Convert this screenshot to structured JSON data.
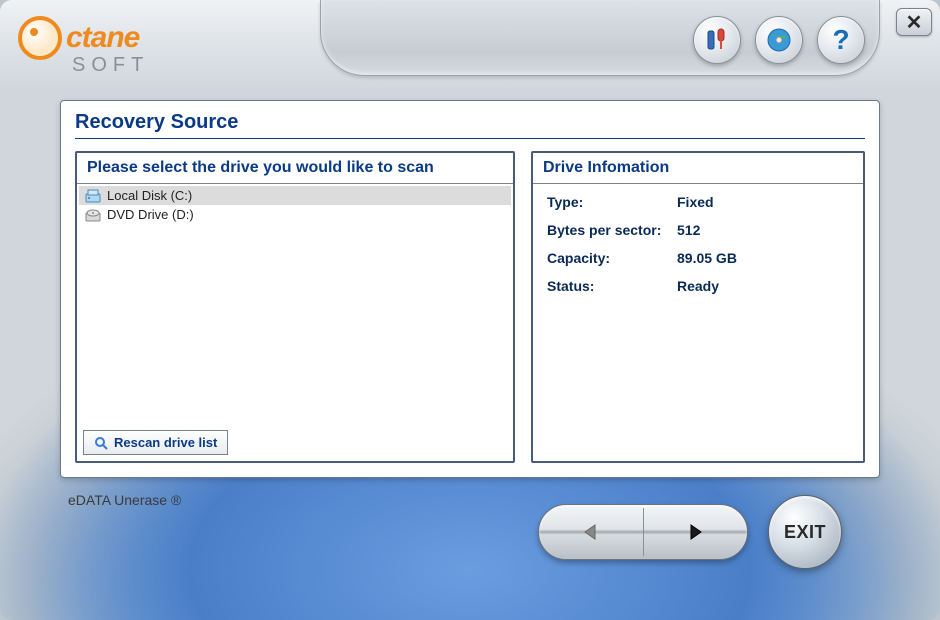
{
  "logo": {
    "word": "ctane",
    "sub": "SOFT"
  },
  "header": {
    "icons": [
      "tools-icon",
      "world-disc-icon",
      "help-icon"
    ]
  },
  "main": {
    "title": "Recovery Source",
    "drive_header": "Please select the drive you would like to scan",
    "drives": [
      {
        "label": "Local Disk (C:)",
        "icon": "hdd-icon",
        "selected": true
      },
      {
        "label": "DVD Drive (D:)",
        "icon": "dvd-icon",
        "selected": false
      }
    ],
    "rescan_label": "Rescan drive list",
    "info_header": "Drive Infomation",
    "info": [
      {
        "label": "Type:",
        "value": "Fixed"
      },
      {
        "label": "Bytes per sector:",
        "value": "512"
      },
      {
        "label": "Capacity:",
        "value": "89.05 GB"
      },
      {
        "label": "Status:",
        "value": "Ready"
      }
    ]
  },
  "footer": {
    "product": "eDATA Unerase ®"
  },
  "nav": {
    "exit": "EXIT"
  }
}
